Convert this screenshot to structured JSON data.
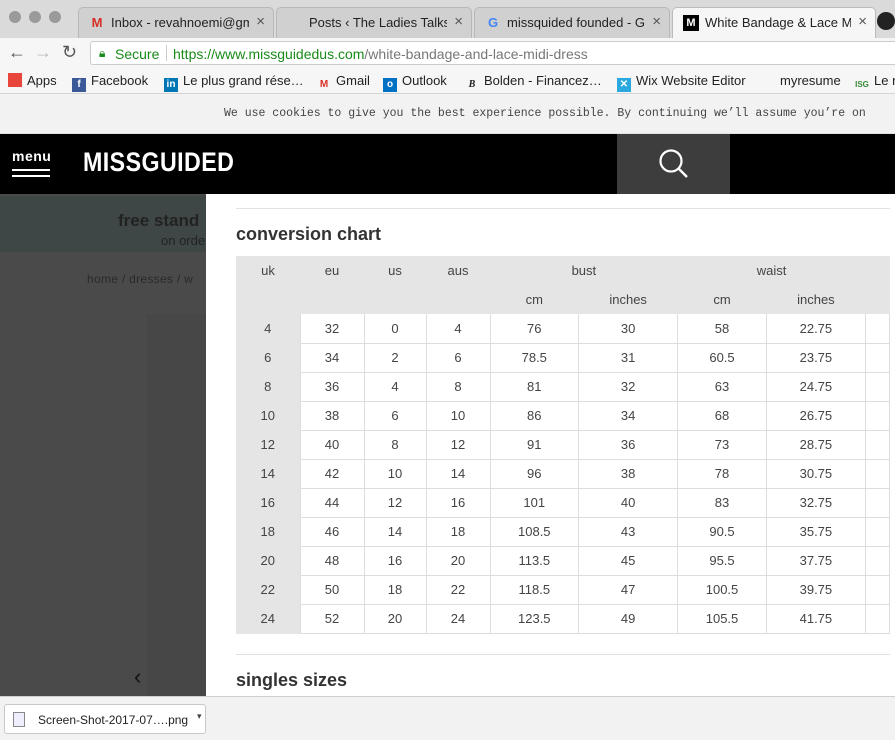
{
  "browser": {
    "tabs": [
      {
        "label": "Inbox - revahnoemi@gma",
        "icon": "gmail-icon"
      },
      {
        "label": "Posts ‹ The Ladies Talksh",
        "icon": "wordpress-icon"
      },
      {
        "label": "missquided founded - Go",
        "icon": "google-icon"
      },
      {
        "label": "White Bandage & Lace M",
        "icon": "missguided-icon"
      }
    ],
    "close_glyph": "×",
    "secure_label": "Secure",
    "url_host": "https://www.missguidedus.com",
    "url_path": "/white-bandage-and-lace-midi-dress",
    "bookmarks": [
      "Apps",
      "Facebook",
      "Le plus grand rése…",
      "Gmail",
      "Outlook",
      "Bolden - Financez…",
      "Wix Website Editor",
      "myresume",
      "Le r"
    ]
  },
  "page": {
    "cookie_text": "We use cookies to give you the best experience possible. By continuing we’ll assume you’re on",
    "menu_label": "menu",
    "logo_text": "MISSGUIDED",
    "promo_line1": "free stand",
    "promo_line2": "on orde",
    "breadcrumb": "home / dresses / w",
    "back_arrow": "‹"
  },
  "size_modal": {
    "section_title": "conversion chart",
    "bottom_title": "singles sizes",
    "header_row1": [
      "uk",
      "eu",
      "us",
      "aus",
      "bust",
      "waist"
    ],
    "header_row2": [
      "cm",
      "inches",
      "cm",
      "inches"
    ],
    "rows": [
      [
        "4",
        "32",
        "0",
        "4",
        "76",
        "30",
        "58",
        "22.75"
      ],
      [
        "6",
        "34",
        "2",
        "6",
        "78.5",
        "31",
        "60.5",
        "23.75"
      ],
      [
        "8",
        "36",
        "4",
        "8",
        "81",
        "32",
        "63",
        "24.75"
      ],
      [
        "10",
        "38",
        "6",
        "10",
        "86",
        "34",
        "68",
        "26.75"
      ],
      [
        "12",
        "40",
        "8",
        "12",
        "91",
        "36",
        "73",
        "28.75"
      ],
      [
        "14",
        "42",
        "10",
        "14",
        "96",
        "38",
        "78",
        "30.75"
      ],
      [
        "16",
        "44",
        "12",
        "16",
        "101",
        "40",
        "83",
        "32.75"
      ],
      [
        "18",
        "46",
        "14",
        "18",
        "108.5",
        "43",
        "90.5",
        "35.75"
      ],
      [
        "20",
        "48",
        "16",
        "20",
        "113.5",
        "45",
        "95.5",
        "37.75"
      ],
      [
        "22",
        "50",
        "18",
        "22",
        "118.5",
        "47",
        "100.5",
        "39.75"
      ],
      [
        "24",
        "52",
        "20",
        "24",
        "123.5",
        "49",
        "105.5",
        "41.75"
      ]
    ]
  },
  "downloads": {
    "file_name": "Screen-Shot-2017-07….png",
    "caret": "▾"
  },
  "colors": {
    "secure_green": "#1a8a1a",
    "header_black": "#000000",
    "search_bg": "#3d3d3d",
    "overlay": "#4a4a4a"
  }
}
